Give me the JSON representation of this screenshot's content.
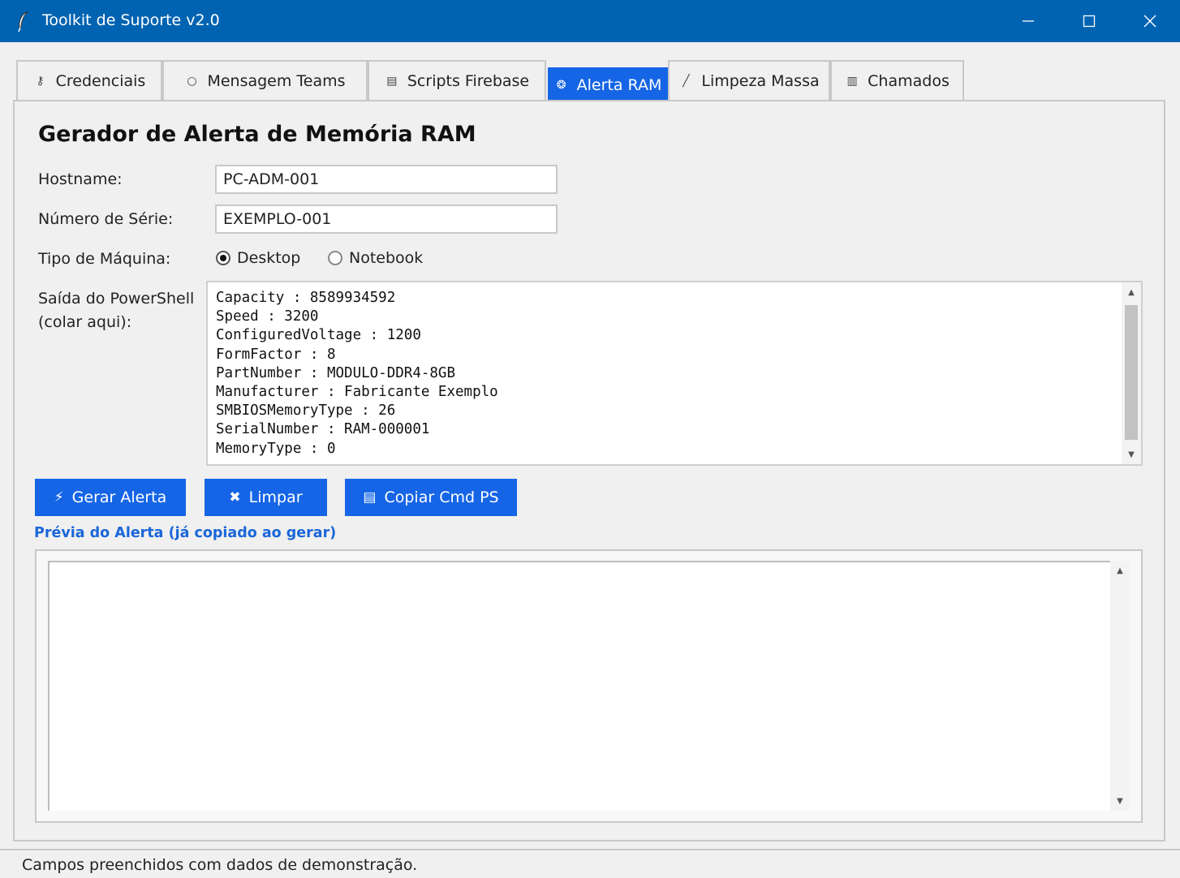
{
  "window": {
    "title": "Toolkit de Suporte v2.0",
    "app_icon": "feather-icon",
    "controls": {
      "minimize": "—",
      "maximize": "☐",
      "close": "✕"
    }
  },
  "tabs": [
    {
      "icon": "key-icon",
      "glyph": "⚷",
      "label": "Credenciais"
    },
    {
      "icon": "chat-bubble-icon",
      "glyph": "○",
      "label": "Mensagem Teams"
    },
    {
      "icon": "document-icon",
      "glyph": "▤",
      "label": "Scripts Firebase"
    },
    {
      "icon": "brain-icon",
      "glyph": "❂",
      "label": "Alerta RAM"
    },
    {
      "icon": "broom-icon",
      "glyph": "╱",
      "label": "Limpeza Massa"
    },
    {
      "icon": "clipboard-icon",
      "glyph": "▥",
      "label": "Chamados"
    }
  ],
  "active_tab": "Alerta RAM",
  "form": {
    "heading": "Gerador de Alerta de Memória RAM",
    "hostname_label": "Hostname:",
    "hostname_value": "PC-ADM-001",
    "serial_label": "Número de Série:",
    "serial_value": "EXEMPLO-001",
    "machine_type_label": "Tipo de Máquina:",
    "machine_type_options": [
      "Desktop",
      "Notebook"
    ],
    "machine_type_selected": "Desktop",
    "ps_label_line1": "Saída do PowerShell",
    "ps_label_line2": "(colar aqui):",
    "ps_output": "Capacity : 8589934592\nSpeed : 3200\nConfiguredVoltage : 1200\nFormFactor : 8\nPartNumber : MODULO-DDR4-8GB\nManufacturer : Fabricante Exemplo\nSMBIOSMemoryType : 26\nSerialNumber : RAM-000001\nMemoryType : 0"
  },
  "buttons": {
    "generate": {
      "icon": "lightning-icon",
      "glyph": "⚡",
      "label": "Gerar Alerta"
    },
    "clear": {
      "icon": "x-mark-icon",
      "glyph": "✖",
      "label": "Limpar"
    },
    "copy": {
      "icon": "clipboard-icon",
      "glyph": "▤",
      "label": "Copiar Cmd PS"
    }
  },
  "preview": {
    "label": "Prévia do Alerta (já copiado ao gerar)",
    "content": ""
  },
  "status": "Campos preenchidos com dados de demonstração.",
  "colors": {
    "titlebar": "#0063b1",
    "accent": "#1565e6",
    "preview_label": "#1a66d9"
  }
}
